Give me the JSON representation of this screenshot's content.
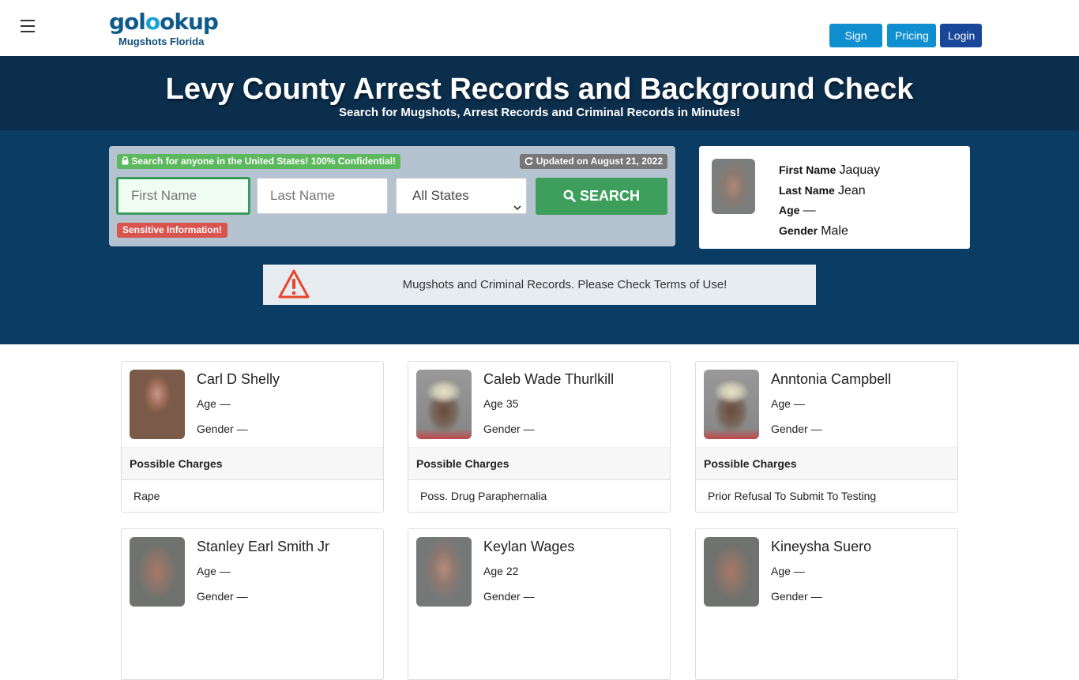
{
  "header": {
    "menu_icon": "hamburger-icon",
    "logo_main_part1": "gol",
    "logo_main_part2": "o",
    "logo_main_part3": "okup",
    "logo_sub": "Mugshots Florida",
    "buttons": {
      "signup": "Sign Up",
      "pricing": "Pricing",
      "login": "Login"
    }
  },
  "hero": {
    "title": "Levy County Arrest Records and Background Check",
    "subtitle": "Search for Mugshots, Arrest Records and Criminal Records in Minutes!"
  },
  "search": {
    "confidential_badge": "Search for anyone in the United States! 100% Confidential!",
    "confidential_icon": "lock-icon",
    "updated_badge": "Updated on August 21, 2022",
    "updated_icon": "refresh-icon",
    "first_name_placeholder": "First Name",
    "last_name_placeholder": "Last Name",
    "state_selected": "All States",
    "search_button": "SEARCH",
    "search_icon": "search-icon",
    "sensitive_badge": "Sensitive Information!"
  },
  "profile": {
    "first_name_label": "First Name",
    "first_name": "Jaquay",
    "last_name_label": "Last Name",
    "last_name": "Jean",
    "age_label": "Age",
    "age": "—",
    "gender_label": "Gender",
    "gender": "Male"
  },
  "notice": {
    "icon": "warning-icon",
    "text": "Mugshots and Criminal Records. Please Check Terms of Use!"
  },
  "records": {
    "age_label": "Age",
    "gender_label": "Gender",
    "charges_label": "Possible Charges",
    "items": [
      {
        "name": "Carl D Shelly",
        "age": "—",
        "gender": "—",
        "charge": "Rape"
      },
      {
        "name": "Caleb Wade Thurlkill",
        "age": "35",
        "gender": "—",
        "charge": "Poss. Drug Paraphernalia"
      },
      {
        "name": "Anntonia Campbell",
        "age": "—",
        "gender": "—",
        "charge": "Prior Refusal To Submit To Testing"
      },
      {
        "name": "Stanley Earl Smith Jr",
        "age": "—",
        "gender": "—",
        "charge": ""
      },
      {
        "name": "Keylan Wages",
        "age": "22",
        "gender": "—",
        "charge": ""
      },
      {
        "name": "Kineysha Suero",
        "age": "—",
        "gender": "—",
        "charge": ""
      }
    ]
  },
  "colors": {
    "brand_dark": "#0b2e4c",
    "brand_band": "#0b3c63",
    "primary_button": "#0f8ed0",
    "login_button": "#18479a",
    "search_button": "#3e9f5d",
    "badge_success": "#5cb85c",
    "badge_danger": "#d9534f",
    "warning_icon": "#e8452c"
  }
}
